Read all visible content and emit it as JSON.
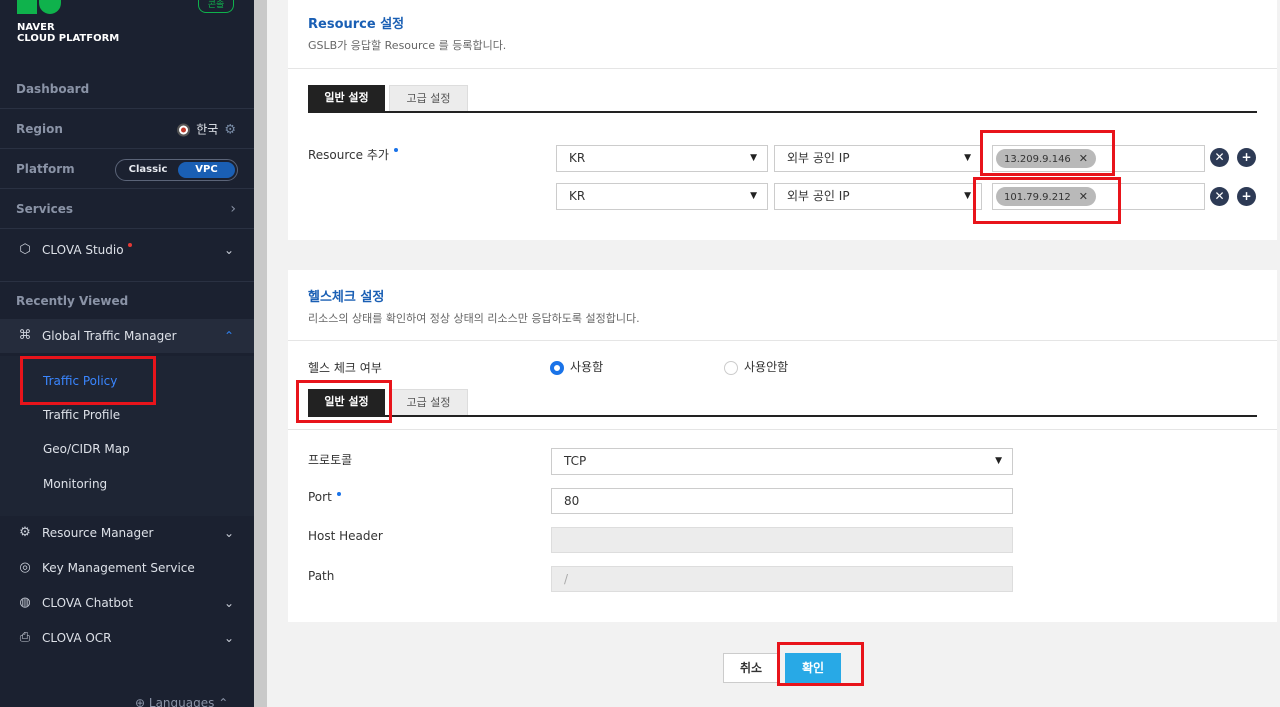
{
  "sidebar": {
    "logo_line1": "NAVER",
    "logo_line2": "CLOUD PLATFORM",
    "console_badge": "콘솔",
    "dashboard": "Dashboard",
    "region_label": "Region",
    "region_value": "한국",
    "platform_label": "Platform",
    "platform_classic": "Classic",
    "platform_vpc": "VPC",
    "services": "Services",
    "clova_studio": "CLOVA Studio",
    "recently_viewed": "Recently Viewed",
    "global_traffic_manager": "Global Traffic Manager",
    "sub_items": [
      "Traffic Policy",
      "Traffic Profile",
      "Geo/CIDR Map",
      "Monitoring"
    ],
    "resource_manager": "Resource Manager",
    "key_management": "Key Management Service",
    "clova_chatbot": "CLOVA Chatbot",
    "clova_ocr": "CLOVA OCR",
    "languages": "Languages"
  },
  "resource": {
    "title": "Resource 설정",
    "desc": "GSLB가 응답할 Resource 를 등록합니다.",
    "tab_general": "일반 설정",
    "tab_advanced": "고급 설정",
    "add_label": "Resource 추가",
    "rows": [
      {
        "region": "KR",
        "type": "외부 공인 IP",
        "ip": "13.209.9.146"
      },
      {
        "region": "KR",
        "type": "외부 공인 IP",
        "ip": "101.79.9.212"
      }
    ]
  },
  "health": {
    "title": "헬스체크 설정",
    "desc": "리소스의 상태를 확인하여 정상 상태의 리소스만 응답하도록 설정합니다.",
    "check_label": "헬스 체크 여부",
    "opt_use": "사용함",
    "opt_nouse": "사용안함",
    "tab_general": "일반 설정",
    "tab_advanced": "고급 설정",
    "protocol_label": "프로토콜",
    "protocol_value": "TCP",
    "port_label": "Port",
    "port_value": "80",
    "host_header_label": "Host Header",
    "path_label": "Path",
    "path_placeholder": "/"
  },
  "actions": {
    "cancel": "취소",
    "confirm": "확인"
  }
}
